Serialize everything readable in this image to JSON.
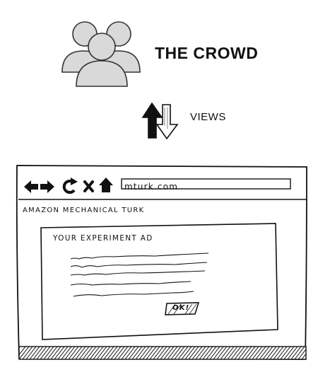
{
  "header": {
    "crowd_title": "THE CROWD",
    "crowd_icon": "people-group-icon",
    "views_label": "VIEWS",
    "views_icon": "up-down-arrows-icon"
  },
  "browser": {
    "toolbar": {
      "icons": [
        "back-arrow-icon",
        "forward-arrow-icon",
        "reload-icon",
        "close-icon",
        "home-icon"
      ]
    },
    "url": "mturk.com",
    "site_title": "AMAZON MECHANICAL TURK",
    "ad": {
      "title": "YOUR EXPERIMENT AD",
      "ok_button": "OK!"
    }
  },
  "colors": {
    "icon_fill": "#d9d9d9",
    "ink": "#111111"
  }
}
